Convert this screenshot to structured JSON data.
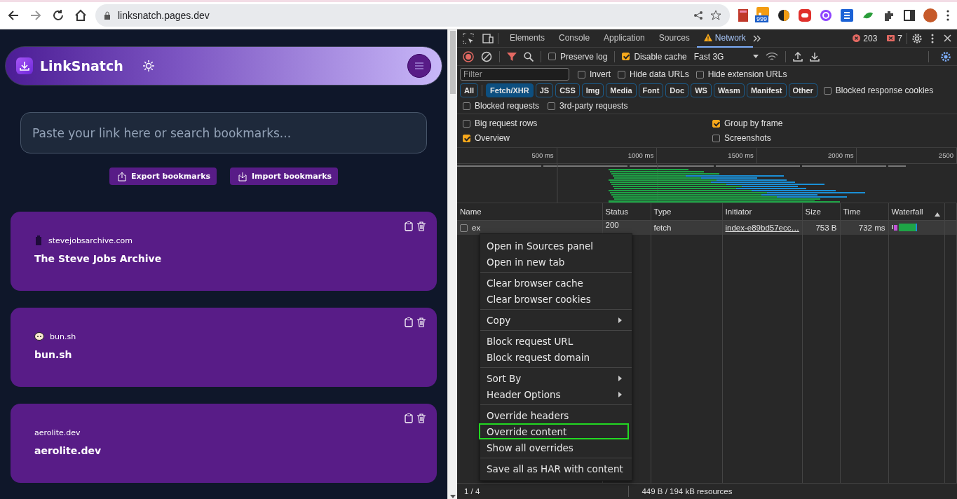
{
  "browser": {
    "url": "linksnatch.pages.dev",
    "extension_badge": "999"
  },
  "app": {
    "title": "LinkSnatch",
    "search_placeholder": "Paste your link here or search bookmarks...",
    "buttons": [
      {
        "label": "Export bookmarks",
        "kind": "export"
      },
      {
        "label": "Import bookmarks",
        "kind": "import"
      }
    ],
    "bookmarks": [
      {
        "domain": "stevejobsarchive.com",
        "title": "The Steve Jobs Archive",
        "kind": "building"
      },
      {
        "domain": "bun.sh",
        "title": "bun.sh",
        "kind": "bun"
      },
      {
        "domain": "aerolite.dev",
        "title": "aerolite.dev",
        "kind": "none"
      }
    ]
  },
  "devtools": {
    "tabs": [
      {
        "label": "Elements",
        "selected": false,
        "warning": false
      },
      {
        "label": "Console",
        "selected": false,
        "warning": false
      },
      {
        "label": "Application",
        "selected": false,
        "warning": false
      },
      {
        "label": "Sources",
        "selected": false,
        "warning": false
      },
      {
        "label": "Network",
        "selected": true,
        "warning": true
      }
    ],
    "errors": "203",
    "warnings": "7",
    "toolbar": [
      {
        "label": "Preserve log",
        "checked": false
      },
      {
        "label": "Disable cache",
        "checked": true
      }
    ],
    "throttle": "Fast 3G",
    "filter_placeholder": "Filter",
    "filter_options": [
      {
        "label": "Invert",
        "checked": false
      },
      {
        "label": "Hide data URLs",
        "checked": false
      },
      {
        "label": "Hide extension URLs",
        "checked": false
      }
    ],
    "types": [
      {
        "label": "All",
        "selected": false
      },
      {
        "label": "Fetch/XHR",
        "selected": true
      },
      {
        "label": "JS",
        "selected": false
      },
      {
        "label": "CSS",
        "selected": false
      },
      {
        "label": "Img",
        "selected": false
      },
      {
        "label": "Media",
        "selected": false
      },
      {
        "label": "Font",
        "selected": false
      },
      {
        "label": "Doc",
        "selected": false
      },
      {
        "label": "WS",
        "selected": false
      },
      {
        "label": "Wasm",
        "selected": false
      },
      {
        "label": "Manifest",
        "selected": false
      },
      {
        "label": "Other",
        "selected": false
      }
    ],
    "type_options": [
      {
        "label": "Blocked response cookies",
        "checked": false
      }
    ],
    "request_options": [
      {
        "label": "Blocked requests",
        "checked": false
      },
      {
        "label": "3rd-party requests",
        "checked": false
      }
    ],
    "settings": [
      {
        "label": "Big request rows",
        "checked": false
      },
      {
        "label": "Group by frame",
        "checked": true
      },
      {
        "label": "Overview",
        "checked": true
      },
      {
        "label": "Screenshots",
        "checked": false
      }
    ],
    "timeline_ticks": [
      "500 ms",
      "1000 ms",
      "1500 ms",
      "2000 ms",
      "2500"
    ],
    "columns": [
      "Name",
      "Status",
      "Type",
      "Initiator",
      "Size",
      "Time",
      "Waterfall"
    ],
    "rows": [
      {
        "checked": false,
        "name": "ex",
        "status": "200",
        "type": "fetch",
        "initiator": "index-e89bd57ecc…",
        "size": "753 B",
        "time": "732 ms"
      }
    ],
    "status_bar": [
      "1 / 4",
      "449 B / 194 kB resources"
    ]
  },
  "context_menu": [
    [
      {
        "label": "Open in Sources panel",
        "submenu": false,
        "highlighted": false
      },
      {
        "label": "Open in new tab",
        "submenu": false,
        "highlighted": false
      }
    ],
    [
      {
        "label": "Clear browser cache",
        "submenu": false,
        "highlighted": false
      },
      {
        "label": "Clear browser cookies",
        "submenu": false,
        "highlighted": false
      }
    ],
    [
      {
        "label": "Copy",
        "submenu": true,
        "highlighted": false
      }
    ],
    [
      {
        "label": "Block request URL",
        "submenu": false,
        "highlighted": false
      },
      {
        "label": "Block request domain",
        "submenu": false,
        "highlighted": false
      }
    ],
    [
      {
        "label": "Sort By",
        "submenu": true,
        "highlighted": false
      },
      {
        "label": "Header Options",
        "submenu": true,
        "highlighted": false
      }
    ],
    [
      {
        "label": "Override headers",
        "submenu": false,
        "highlighted": false
      },
      {
        "label": "Override content",
        "submenu": false,
        "highlighted": true
      },
      {
        "label": "Show all overrides",
        "submenu": false,
        "highlighted": false
      }
    ],
    [
      {
        "label": "Save all as HAR with content",
        "submenu": false,
        "highlighted": false
      }
    ]
  ]
}
